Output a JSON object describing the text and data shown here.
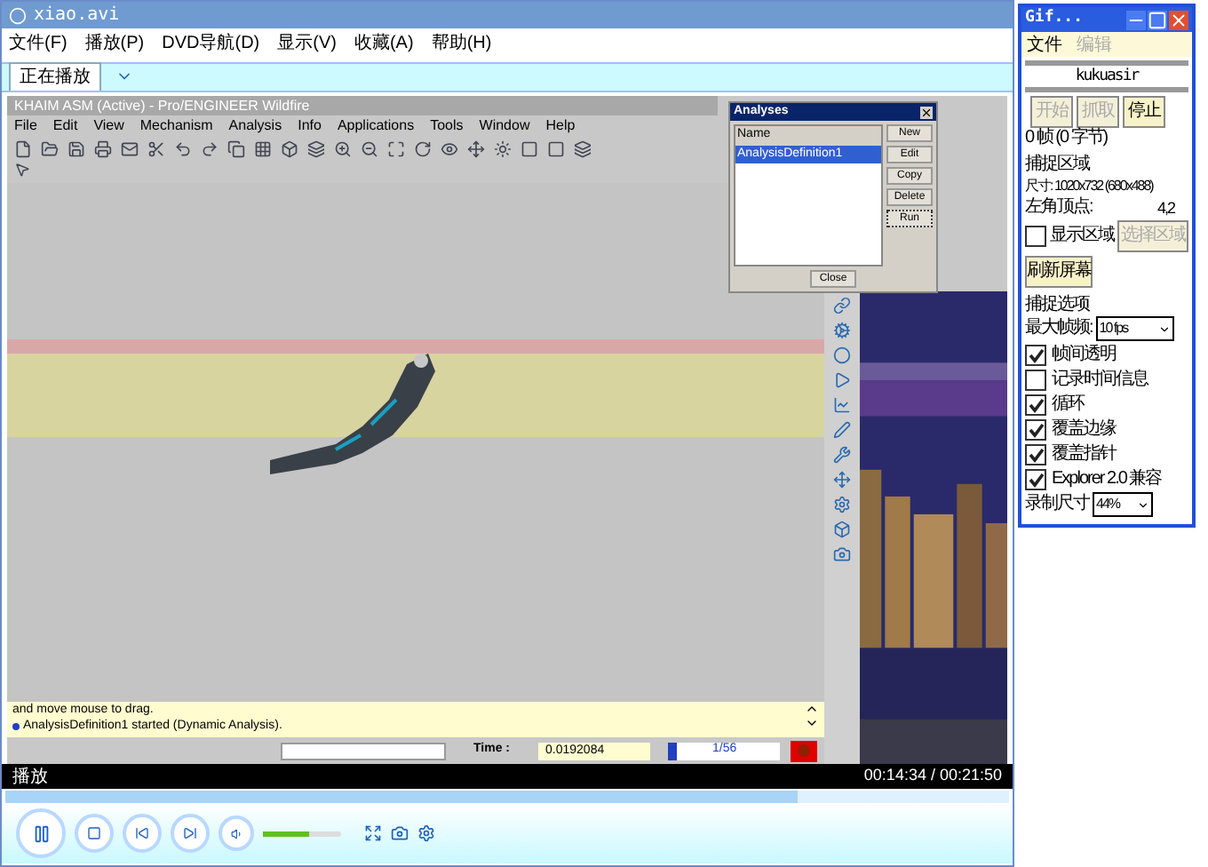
{
  "player": {
    "title": "xiao.avi",
    "menu": [
      "文件(F)",
      "播放(P)",
      "DVD导航(D)",
      "显示(V)",
      "收藏(A)",
      "帮助(H)"
    ],
    "tabs": [
      {
        "label": "正在播放",
        "selected": true
      }
    ],
    "status": "播放",
    "time": "00:14:34 / 00:21:50",
    "seek": {
      "level": 0.79
    },
    "volume": {
      "level": 0.58
    }
  },
  "proe": {
    "title": "KHAIM ASM (Active) - Pro/ENGINEER Wildfire",
    "menu": [
      "File",
      "Edit",
      "View",
      "Mechanism",
      "Analysis",
      "Info",
      "Applications",
      "Tools",
      "Window",
      "Help"
    ],
    "messages": [
      {
        "text": "and move mouse to drag.",
        "bullet": false
      },
      {
        "text": "AnalysisDefinition1 started (Dynamic Analysis).",
        "bullet": true
      }
    ],
    "time_label": "Time :",
    "time_value": "0.0192084",
    "progress": {
      "level": 0.08,
      "reading": "1/56"
    }
  },
  "analyses": {
    "title": "Analyses",
    "column": "Name",
    "items": [
      {
        "label": "AnalysisDefinition1",
        "selected": true
      }
    ],
    "buttons": [
      {
        "label": "New",
        "focused": false
      },
      {
        "label": "Edit",
        "focused": false
      },
      {
        "label": "Copy",
        "focused": false
      },
      {
        "label": "Delete",
        "focused": false
      },
      {
        "label": "Run",
        "focused": true
      }
    ],
    "close": "Close"
  },
  "gif": {
    "title": "Gif...",
    "menu": [
      {
        "label": "文件",
        "disabled": false
      },
      {
        "label": "编辑",
        "disabled": true
      }
    ],
    "name": "kukuasir",
    "buttons": [
      {
        "label": "开始",
        "disabled": true
      },
      {
        "label": "抓取",
        "disabled": true
      },
      {
        "label": "停止",
        "disabled": false
      }
    ],
    "frames": "0 帧 (0 字节)",
    "area_title": "捕捉区域",
    "size": "尺寸: 1020x732 (680x488)",
    "corner_label": "左角顶点:",
    "corner": "4,2",
    "show_area": {
      "label": "显示区域",
      "checked": false
    },
    "select_area": {
      "label": "选择区域",
      "disabled": true
    },
    "refresh": "刷新屏幕",
    "options_title": "捕捉选项",
    "fps_label": "最大帧频:",
    "fps": "10 fps",
    "options": [
      {
        "label": "帧间透明",
        "checked": true
      },
      {
        "label": "记录时间信息",
        "checked": false
      },
      {
        "label": "循环",
        "checked": true
      },
      {
        "label": "覆盖边缘",
        "checked": true
      },
      {
        "label": "覆盖指针",
        "checked": true
      },
      {
        "label": "Explorer 2.0 兼容",
        "checked": true
      }
    ],
    "rec_label": "录制尺寸",
    "rec_size": "44%"
  }
}
